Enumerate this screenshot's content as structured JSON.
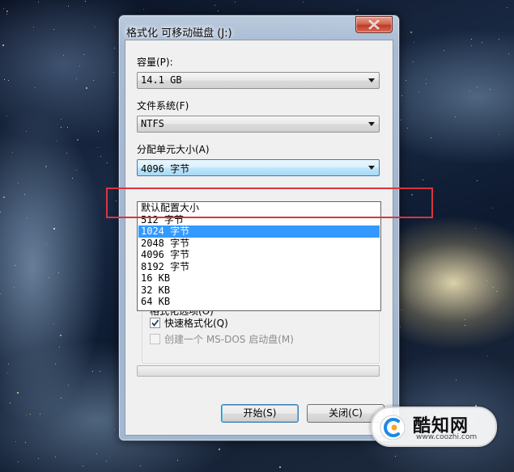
{
  "window": {
    "title": "格式化 可移动磁盘 (J:)"
  },
  "capacity": {
    "label": "容量(P):",
    "value": "14.1 GB"
  },
  "filesystem": {
    "label": "文件系统(F)",
    "value": "NTFS"
  },
  "allocation": {
    "label": "分配单元大小(A)",
    "value": "4096 字节",
    "options": [
      "默认配置大小",
      "512 字节",
      "1024 字节",
      "2048 字节",
      "4096 字节",
      "8192 字节",
      "16 KB",
      "32 KB",
      "64 KB"
    ],
    "highlighted_option": "1024 字节"
  },
  "format_options": {
    "group_label": "格式化选项(O)",
    "quick_format": {
      "label": "快速格式化(Q)",
      "checked": true,
      "enabled": true
    },
    "msdos_boot": {
      "label": "创建一个 MS-DOS 启动盘(M)",
      "checked": false,
      "enabled": false
    }
  },
  "progress": {
    "value": 0
  },
  "buttons": {
    "start": "开始(S)",
    "close": "关闭(C)"
  },
  "watermark": {
    "name": "酷知网",
    "url": "www.coozhi.com"
  },
  "colors": {
    "selection": "#3399ff",
    "annotation_box": "#d9353f",
    "close_button": "#c0392b"
  }
}
